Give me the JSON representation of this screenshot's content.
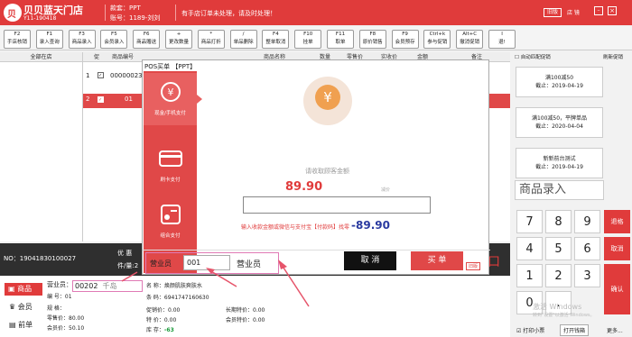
{
  "topbar": {
    "store": "贝贝蓝天门店",
    "store_id": "Y11-190418",
    "pos_line": "款套：PPT",
    "account_line": "账号：1189-刘刘",
    "notice": "有手店订单未处理，请及时处理！",
    "btn": "旧版",
    "user": "店 镜",
    "logo": "贝"
  },
  "toolbar": [
    {
      "k": "F2",
      "l": "手店核销"
    },
    {
      "k": "F1",
      "l": "录入查询"
    },
    {
      "k": "F3",
      "l": "商品录入"
    },
    {
      "k": "F5",
      "l": "会员录入"
    },
    {
      "k": "F6",
      "l": "商品赠送"
    },
    {
      "k": "+",
      "l": "更改数量"
    },
    {
      "k": "*",
      "l": "商品打折"
    },
    {
      "k": "/",
      "l": "单品删除"
    },
    {
      "k": "F4",
      "l": "整单取消"
    },
    {
      "k": "F10",
      "l": "挂单"
    },
    {
      "k": "F11",
      "l": "取单"
    },
    {
      "k": "F8",
      "l": "原价销售"
    },
    {
      "k": "F9",
      "l": "会员预存"
    },
    {
      "k": "Ctrl+k",
      "l": "参与促销"
    },
    {
      "k": "Alt+C",
      "l": "撤消促销"
    },
    {
      "k": "I",
      "l": "退!"
    }
  ],
  "leftcat": {
    "header": "全部在店"
  },
  "grid": {
    "headers": [
      "促",
      "商品编号",
      "商品名称",
      "数量",
      "零售价",
      "实收价",
      "金额",
      "备注"
    ],
    "rows": [
      {
        "n": "1",
        "code": "000000231"
      },
      {
        "n": "2",
        "code": "01"
      }
    ]
  },
  "right": {
    "auto_promo": "自动匹配促销",
    "manual_promo": "刷新促销",
    "promos": [
      {
        "t": "满100减50",
        "d": "截止：2019-04-19"
      },
      {
        "t": "满100减50，平牌单品",
        "d": "截止：2020-04-04"
      },
      {
        "t": "新新前台测试",
        "d": "截止：2019-04-19"
      }
    ],
    "product_entry": "商品录入",
    "keys": [
      "7",
      "8",
      "9",
      "4",
      "5",
      "6",
      "1",
      "2",
      "3",
      "0",
      "."
    ],
    "side": [
      "退格",
      "取消",
      "确认"
    ],
    "print": "打印小票",
    "open_drawer": "打开钱箱",
    "more": "更多...",
    "watermark": "激活 Windows",
    "watermark2": "转到\"设置\"以激活 Windows。"
  },
  "dark": {
    "no": "NO：19041830100027",
    "a": "优 惠",
    "b": "件/量:2",
    "c": "口"
  },
  "bottom": {
    "tabs": [
      "商品",
      "会员",
      "前单"
    ],
    "clerk_label": "营业员：",
    "clerk_code": "00202",
    "clerk_name": "千岛",
    "code_label": "编 号：01",
    "spec_label": "规 格：",
    "retail_label": "零售价：80.00",
    "member_label": "会员价：50.10",
    "name_label": "名 称：焕颜肌肤爽肤水",
    "barcode_label": "条 码：6941747160630",
    "promo_price": "促销价：0.00",
    "special_price": "特 价：0.00",
    "long_special": "长期特价：0.00",
    "member_special": "会员特价：0.00",
    "stock_label": "库 存：",
    "stock_value": "-63"
  },
  "modal": {
    "title": "POS买单 【PPT】",
    "methods": [
      "现金/手机支付",
      "刷卡支付",
      "组合支付"
    ],
    "amount_caption": "请收取顾客金额",
    "amount": "89.90",
    "reduce": "减价",
    "hint": "输入收款金额或微信与支付宝【付款码】找零",
    "change": "-89.90",
    "clerk_label": "营业员",
    "clerk_value": "001",
    "clerk_tag": "营业员",
    "cancel": "取 消",
    "pay": "买 单",
    "badge": "旧版"
  },
  "colors": {
    "brand": "#e03b3b"
  }
}
